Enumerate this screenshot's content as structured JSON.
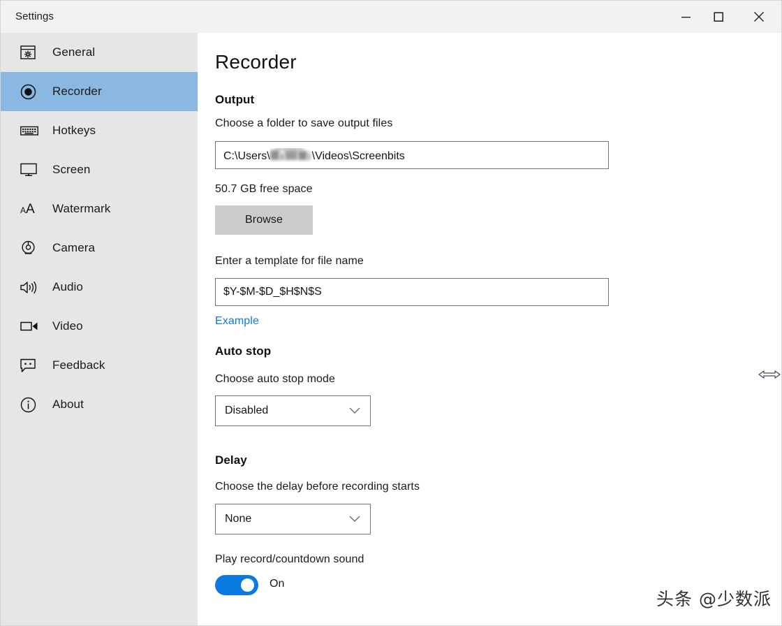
{
  "window": {
    "title": "Settings",
    "caption": {
      "minimize": "minimize",
      "maximize": "maximize",
      "close": "close"
    }
  },
  "sidebar": {
    "items": [
      {
        "label": "General",
        "icon": "window-gear-icon",
        "selected": false
      },
      {
        "label": "Recorder",
        "icon": "record-circle-icon",
        "selected": true
      },
      {
        "label": "Hotkeys",
        "icon": "keyboard-icon",
        "selected": false
      },
      {
        "label": "Screen",
        "icon": "monitor-icon",
        "selected": false
      },
      {
        "label": "Watermark",
        "icon": "text-size-icon",
        "selected": false
      },
      {
        "label": "Camera",
        "icon": "webcam-icon",
        "selected": false
      },
      {
        "label": "Audio",
        "icon": "speaker-icon",
        "selected": false
      },
      {
        "label": "Video",
        "icon": "video-camera-icon",
        "selected": false
      },
      {
        "label": "Feedback",
        "icon": "chat-icon",
        "selected": false
      },
      {
        "label": "About",
        "icon": "info-icon",
        "selected": false
      }
    ]
  },
  "main": {
    "page_title": "Recorder",
    "output": {
      "heading": "Output",
      "folder_label": "Choose a folder to save output files",
      "folder_path_prefix": "C:\\Users\\",
      "folder_path_suffix": "\\Videos\\Screenbits",
      "free_space": "50.7 GB free space",
      "browse_button": "Browse",
      "template_label": "Enter a template for file name",
      "template_value": "$Y-$M-$D_$H$N$S",
      "example_link": "Example"
    },
    "auto_stop": {
      "heading": "Auto stop",
      "label": "Choose auto stop mode",
      "selected": "Disabled"
    },
    "delay": {
      "heading": "Delay",
      "label": "Choose the delay before recording starts",
      "selected": "None",
      "sound_label": "Play record/countdown sound",
      "sound_state": "On"
    }
  },
  "overlay": {
    "watermark": "头条 @少数派",
    "cursor": "horizontal-resize-cursor"
  },
  "colors": {
    "accent": "#0a7ae0",
    "selection": "#8ab8e0",
    "sidebar_bg": "#e6e6e6",
    "titlebar_bg": "#f2f2f2",
    "link": "#0c7ae0",
    "button_bg": "#cccccc",
    "field_border": "#757575"
  }
}
